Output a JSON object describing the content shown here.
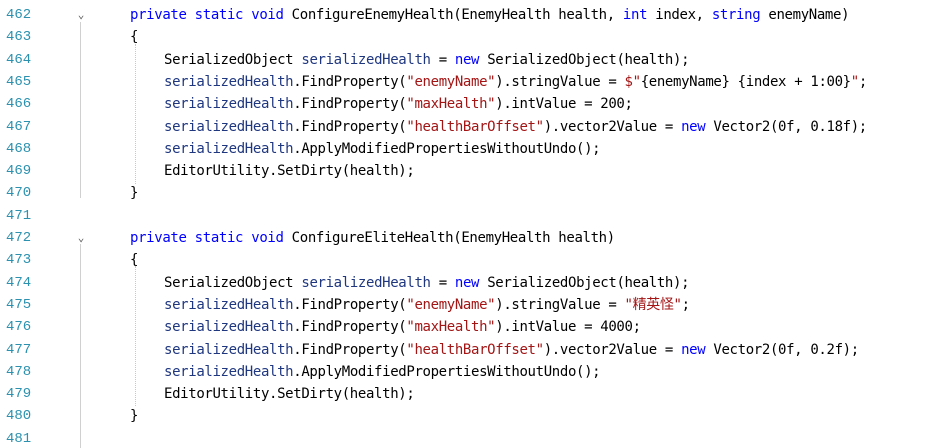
{
  "editor": {
    "lines": [
      {
        "num": "462",
        "fold": "⌄",
        "indent": 0,
        "tokens": [
          {
            "t": "private",
            "c": "kw"
          },
          {
            "t": " ",
            "c": "pl"
          },
          {
            "t": "static",
            "c": "kw"
          },
          {
            "t": " ",
            "c": "pl"
          },
          {
            "t": "void",
            "c": "kw"
          },
          {
            "t": " ",
            "c": "pl"
          },
          {
            "t": "ConfigureEnemyHealth",
            "c": "pl"
          },
          {
            "t": "(",
            "c": "pl"
          },
          {
            "t": "EnemyHealth",
            "c": "pl"
          },
          {
            "t": " health, ",
            "c": "pl"
          },
          {
            "t": "int",
            "c": "kw"
          },
          {
            "t": " index, ",
            "c": "pl"
          },
          {
            "t": "string",
            "c": "kw"
          },
          {
            "t": " enemyName)",
            "c": "pl"
          }
        ]
      },
      {
        "num": "463",
        "fold": "",
        "indent": 0,
        "tokens": [
          {
            "t": "{",
            "c": "pl"
          }
        ]
      },
      {
        "num": "464",
        "fold": "",
        "indent": 1,
        "tokens": [
          {
            "t": "SerializedObject",
            "c": "pl"
          },
          {
            "t": " ",
            "c": "pl"
          },
          {
            "t": "serializedHealth",
            "c": "id"
          },
          {
            "t": " = ",
            "c": "pl"
          },
          {
            "t": "new",
            "c": "kw"
          },
          {
            "t": " SerializedObject(health);",
            "c": "pl"
          }
        ]
      },
      {
        "num": "465",
        "fold": "",
        "indent": 1,
        "tokens": [
          {
            "t": "serializedHealth",
            "c": "id"
          },
          {
            "t": ".FindProperty(",
            "c": "pl"
          },
          {
            "t": "\"enemyName\"",
            "c": "str"
          },
          {
            "t": ").stringValue = ",
            "c": "pl"
          },
          {
            "t": "$\"",
            "c": "str"
          },
          {
            "t": "{enemyName}",
            "c": "pl"
          },
          {
            "t": " ",
            "c": "str"
          },
          {
            "t": "{index + 1:00}",
            "c": "pl"
          },
          {
            "t": "\"",
            "c": "str"
          },
          {
            "t": ";",
            "c": "pl"
          }
        ]
      },
      {
        "num": "466",
        "fold": "",
        "indent": 1,
        "tokens": [
          {
            "t": "serializedHealth",
            "c": "id"
          },
          {
            "t": ".FindProperty(",
            "c": "pl"
          },
          {
            "t": "\"maxHealth\"",
            "c": "str"
          },
          {
            "t": ").intValue = 200;",
            "c": "pl"
          }
        ]
      },
      {
        "num": "467",
        "fold": "",
        "indent": 1,
        "tokens": [
          {
            "t": "serializedHealth",
            "c": "id"
          },
          {
            "t": ".FindProperty(",
            "c": "pl"
          },
          {
            "t": "\"healthBarOffset\"",
            "c": "str"
          },
          {
            "t": ").vector2Value = ",
            "c": "pl"
          },
          {
            "t": "new",
            "c": "kw"
          },
          {
            "t": " Vector2(0f, 0.18f);",
            "c": "pl"
          }
        ]
      },
      {
        "num": "468",
        "fold": "",
        "indent": 1,
        "tokens": [
          {
            "t": "serializedHealth",
            "c": "id"
          },
          {
            "t": ".ApplyModifiedPropertiesWithoutUndo();",
            "c": "pl"
          }
        ]
      },
      {
        "num": "469",
        "fold": "",
        "indent": 1,
        "tokens": [
          {
            "t": "EditorUtility.SetDirty(health);",
            "c": "pl"
          }
        ]
      },
      {
        "num": "470",
        "fold": "",
        "indent": 0,
        "tokens": [
          {
            "t": "}",
            "c": "pl"
          }
        ]
      },
      {
        "num": "471",
        "fold": "",
        "indent": 0,
        "tokens": []
      },
      {
        "num": "472",
        "fold": "⌄",
        "indent": 0,
        "tokens": [
          {
            "t": "private",
            "c": "kw"
          },
          {
            "t": " ",
            "c": "pl"
          },
          {
            "t": "static",
            "c": "kw"
          },
          {
            "t": " ",
            "c": "pl"
          },
          {
            "t": "void",
            "c": "kw"
          },
          {
            "t": " ",
            "c": "pl"
          },
          {
            "t": "ConfigureEliteHealth",
            "c": "pl"
          },
          {
            "t": "(",
            "c": "pl"
          },
          {
            "t": "EnemyHealth",
            "c": "pl"
          },
          {
            "t": " health)",
            "c": "pl"
          }
        ]
      },
      {
        "num": "473",
        "fold": "",
        "indent": 0,
        "tokens": [
          {
            "t": "{",
            "c": "pl"
          }
        ]
      },
      {
        "num": "474",
        "fold": "",
        "indent": 1,
        "tokens": [
          {
            "t": "SerializedObject",
            "c": "pl"
          },
          {
            "t": " ",
            "c": "pl"
          },
          {
            "t": "serializedHealth",
            "c": "id"
          },
          {
            "t": " = ",
            "c": "pl"
          },
          {
            "t": "new",
            "c": "kw"
          },
          {
            "t": " SerializedObject(health);",
            "c": "pl"
          }
        ]
      },
      {
        "num": "475",
        "fold": "",
        "indent": 1,
        "tokens": [
          {
            "t": "serializedHealth",
            "c": "id"
          },
          {
            "t": ".FindProperty(",
            "c": "pl"
          },
          {
            "t": "\"enemyName\"",
            "c": "str"
          },
          {
            "t": ").stringValue = ",
            "c": "pl"
          },
          {
            "t": "\"精英怪\"",
            "c": "str"
          },
          {
            "t": ";",
            "c": "pl"
          }
        ]
      },
      {
        "num": "476",
        "fold": "",
        "indent": 1,
        "tokens": [
          {
            "t": "serializedHealth",
            "c": "id"
          },
          {
            "t": ".FindProperty(",
            "c": "pl"
          },
          {
            "t": "\"maxHealth\"",
            "c": "str"
          },
          {
            "t": ").intValue = 4000;",
            "c": "pl"
          }
        ]
      },
      {
        "num": "477",
        "fold": "",
        "indent": 1,
        "tokens": [
          {
            "t": "serializedHealth",
            "c": "id"
          },
          {
            "t": ".FindProperty(",
            "c": "pl"
          },
          {
            "t": "\"healthBarOffset\"",
            "c": "str"
          },
          {
            "t": ").vector2Value = ",
            "c": "pl"
          },
          {
            "t": "new",
            "c": "kw"
          },
          {
            "t": " Vector2(0f, 0.2f);",
            "c": "pl"
          }
        ]
      },
      {
        "num": "478",
        "fold": "",
        "indent": 1,
        "tokens": [
          {
            "t": "serializedHealth",
            "c": "id"
          },
          {
            "t": ".ApplyModifiedPropertiesWithoutUndo();",
            "c": "pl"
          }
        ]
      },
      {
        "num": "479",
        "fold": "",
        "indent": 1,
        "tokens": [
          {
            "t": "EditorUtility.SetDirty(health);",
            "c": "pl"
          }
        ]
      },
      {
        "num": "480",
        "fold": "",
        "indent": 0,
        "tokens": [
          {
            "t": "}",
            "c": "pl"
          }
        ]
      },
      {
        "num": "481",
        "fold": "",
        "indent": 0,
        "tokens": []
      }
    ]
  }
}
